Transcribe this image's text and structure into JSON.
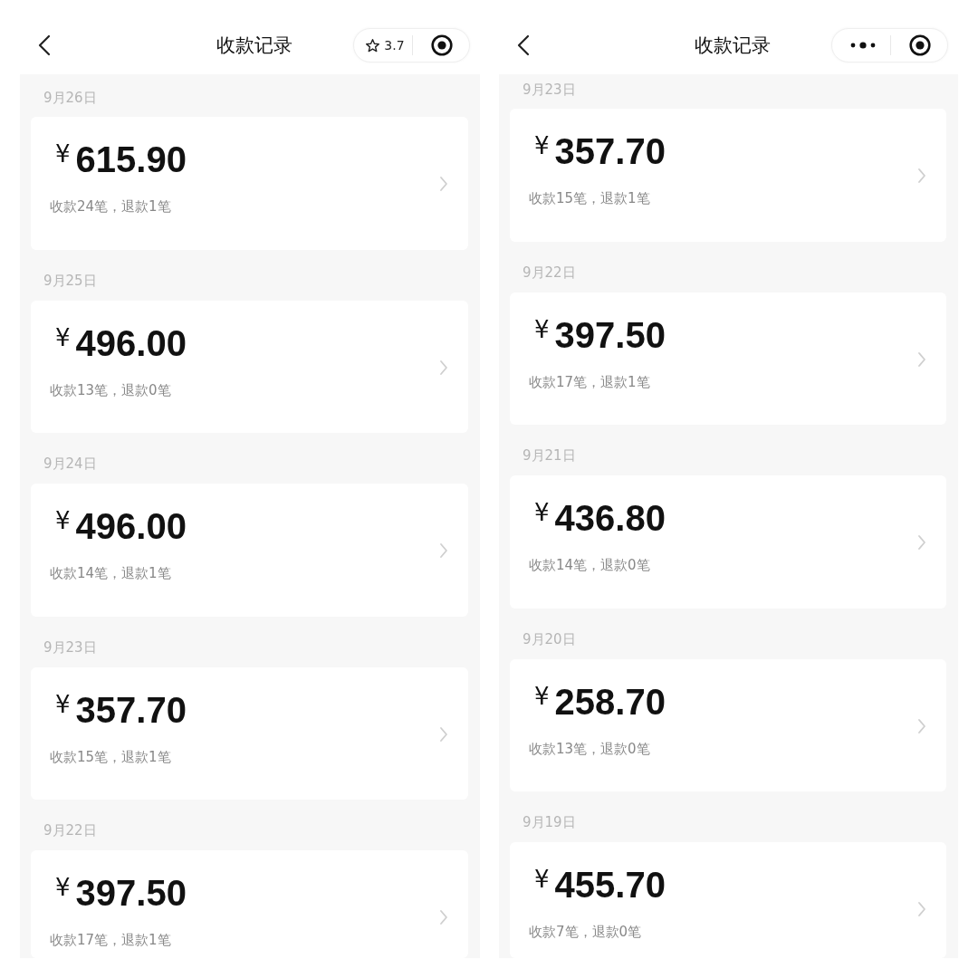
{
  "panels": [
    {
      "nav": {
        "title": "收款记录",
        "capsule": {
          "kind": "rating",
          "rating": "3.7"
        }
      },
      "records": [
        {
          "date": "9月26日",
          "currency": "¥",
          "amount": "615.90",
          "summary": "收款24笔，退款1笔"
        },
        {
          "date": "9月25日",
          "currency": "¥",
          "amount": "496.00",
          "summary": "收款13笔，退款0笔"
        },
        {
          "date": "9月24日",
          "currency": "¥",
          "amount": "496.00",
          "summary": "收款14笔，退款1笔"
        },
        {
          "date": "9月23日",
          "currency": "¥",
          "amount": "357.70",
          "summary": "收款15笔，退款1笔"
        },
        {
          "date": "9月22日",
          "currency": "¥",
          "amount": "397.50",
          "summary": "收款17笔，退款1笔"
        }
      ]
    },
    {
      "nav": {
        "title": "收款记录",
        "capsule": {
          "kind": "menu"
        }
      },
      "records": [
        {
          "date": "9月23日",
          "currency": "¥",
          "amount": "357.70",
          "summary": "收款15笔，退款1笔"
        },
        {
          "date": "9月22日",
          "currency": "¥",
          "amount": "397.50",
          "summary": "收款17笔，退款1笔"
        },
        {
          "date": "9月21日",
          "currency": "¥",
          "amount": "436.80",
          "summary": "收款14笔，退款0笔"
        },
        {
          "date": "9月20日",
          "currency": "¥",
          "amount": "258.70",
          "summary": "收款13笔，退款0笔"
        },
        {
          "date": "9月19日",
          "currency": "¥",
          "amount": "455.70",
          "summary": "收款7笔，退款0笔"
        }
      ]
    }
  ]
}
